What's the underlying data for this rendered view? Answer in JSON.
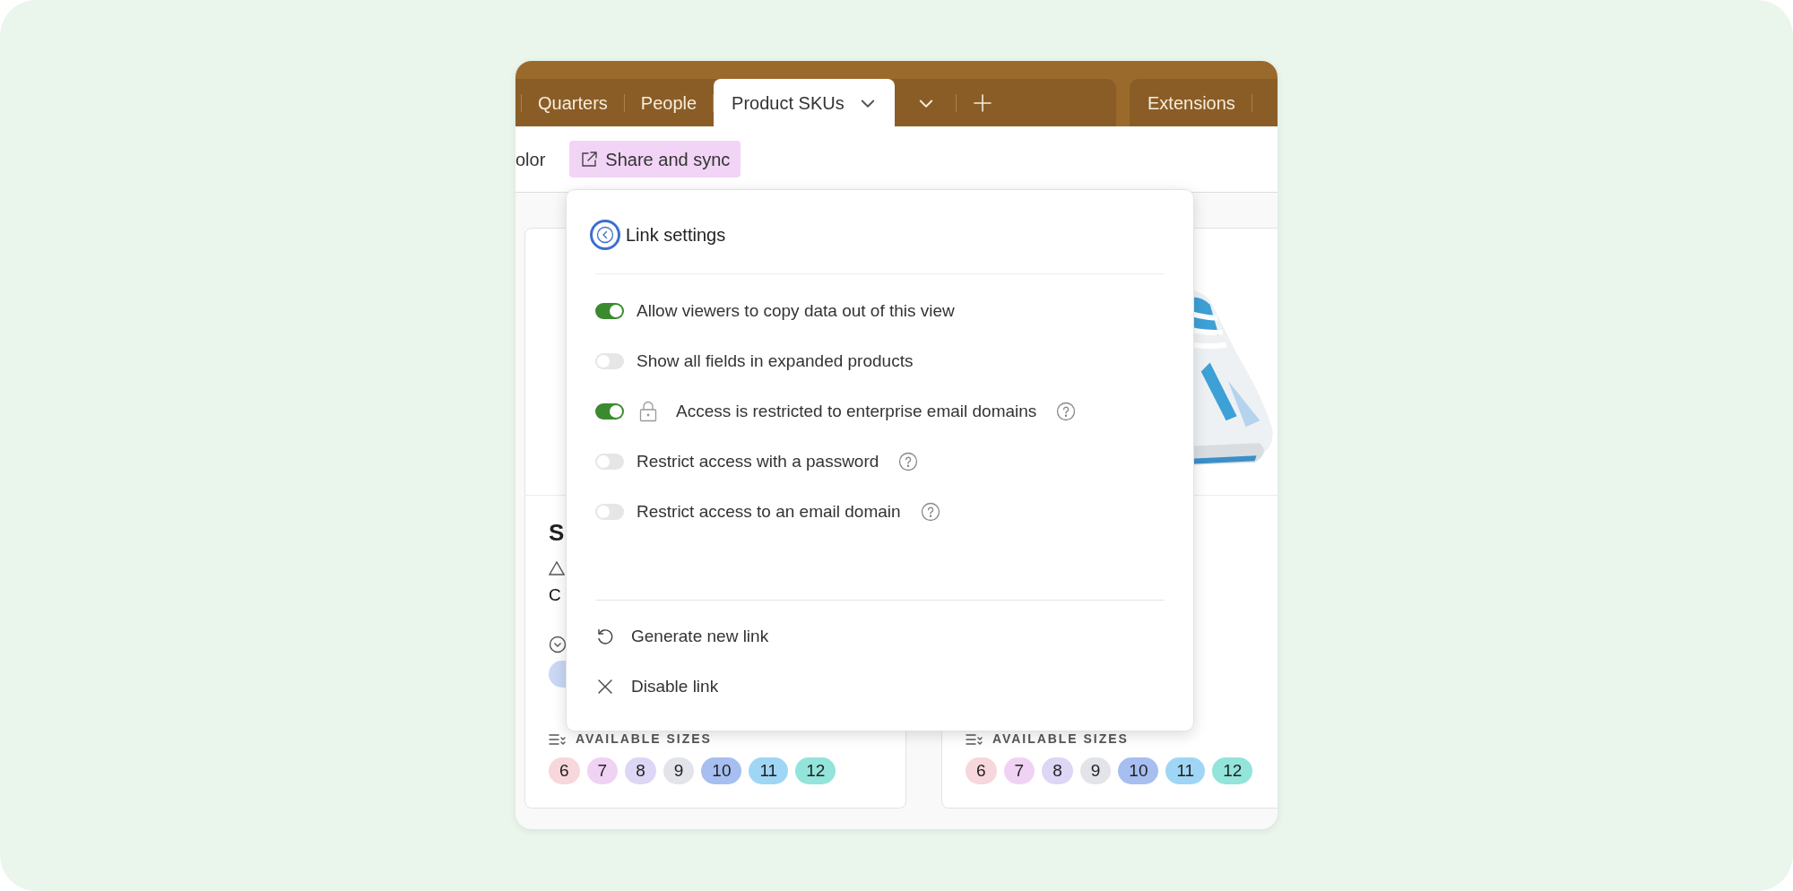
{
  "tabs": [
    {
      "label": "Quarters",
      "selected": false
    },
    {
      "label": "People",
      "selected": false
    },
    {
      "label": "Product SKUs",
      "selected": true
    }
  ],
  "extensions_tab": {
    "label": "Extensions"
  },
  "toolbar": {
    "cut_item": "olor",
    "share_button": "Share and sync"
  },
  "cards": [
    {
      "title": "S",
      "field_value": "C",
      "status_pill": true,
      "sizes_label": "AVAILABLE SIZES",
      "sizes": [
        {
          "label": "6",
          "color": "#f7d6dc"
        },
        {
          "label": "7",
          "color": "#f0d2f4"
        },
        {
          "label": "8",
          "color": "#ddd6f5"
        },
        {
          "label": "9",
          "color": "#e2e4ea"
        },
        {
          "label": "10",
          "color": "#a6bff0"
        },
        {
          "label": "11",
          "color": "#9fd6f5"
        },
        {
          "label": "12",
          "color": "#93e4da"
        }
      ]
    },
    {
      "sizes_label": "AVAILABLE SIZES",
      "sizes": [
        {
          "label": "6",
          "color": "#f7d6dc"
        },
        {
          "label": "7",
          "color": "#f0d2f4"
        },
        {
          "label": "8",
          "color": "#ddd6f5"
        },
        {
          "label": "9",
          "color": "#e2e4ea"
        },
        {
          "label": "10",
          "color": "#a6bff0"
        },
        {
          "label": "11",
          "color": "#9fd6f5"
        },
        {
          "label": "12",
          "color": "#93e4da"
        }
      ]
    }
  ],
  "popover": {
    "title": "Link settings",
    "toggles": [
      {
        "label": "Allow viewers to copy data out of this view",
        "on": true,
        "locked": false,
        "help": false
      },
      {
        "label": "Show all fields in expanded products",
        "on": false,
        "locked": false,
        "help": false
      },
      {
        "label": "Access is restricted to enterprise email domains",
        "on": true,
        "locked": true,
        "help": true
      },
      {
        "label": "Restrict access with a password",
        "on": false,
        "locked": false,
        "help": true
      },
      {
        "label": "Restrict access to an email domain",
        "on": false,
        "locked": false,
        "help": true
      }
    ],
    "actions": [
      {
        "kind": "regenerate",
        "label": "Generate new link"
      },
      {
        "kind": "disable",
        "label": "Disable link"
      }
    ]
  }
}
